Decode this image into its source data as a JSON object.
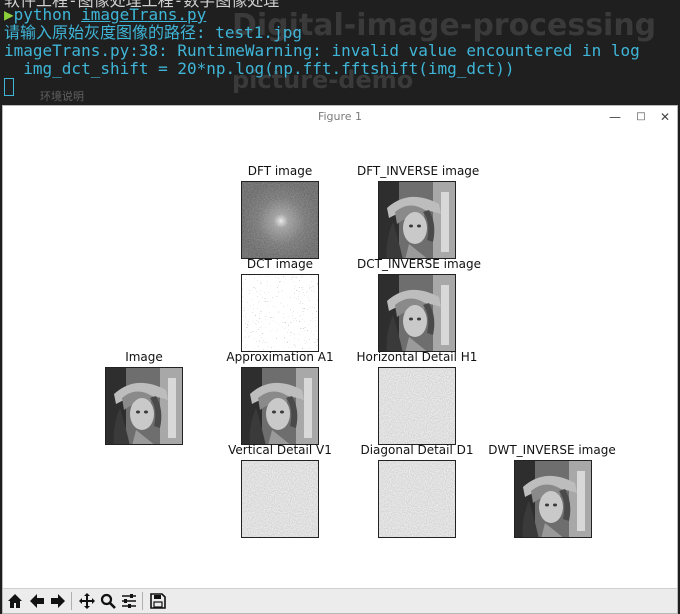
{
  "terminal": {
    "bg_title": "Digital-image-processing",
    "bg_subtitle": "picture-demo",
    "bg_note": "环境说明",
    "line0": "软件工程-图像处理工程-数字图像处理",
    "prompt_arrow": "▶",
    "command": "python",
    "command_arg": "imageTrans.py",
    "line2": "请输入原始灰度图像的路径: test1.jpg",
    "line3": "imageTrans.py:38: RuntimeWarning: invalid value encountered in log",
    "line4": "  img_dct_shift = 20*np.log(np.fft.fftshift(img_dct))"
  },
  "window": {
    "title": "Figure 1",
    "minimize": "—",
    "maximize": "□",
    "close": "✕"
  },
  "subplots": {
    "dft": "DFT image",
    "dft_inverse": "DFT_INVERSE image",
    "dct": "DCT image",
    "dct_inverse": "DCT_INVERSE image",
    "image": "Image",
    "approx": "Approximation A1",
    "horizontal": "Horizontal Detail H1",
    "vertical": "Vertical Detail V1",
    "diagonal": "Diagonal Detail D1",
    "dwt_inverse": "DWT_INVERSE image"
  },
  "toolbar": {
    "icons": [
      "home-icon",
      "back-icon",
      "forward-icon",
      "pan-icon",
      "zoom-icon",
      "configure-subplots-icon",
      "save-icon"
    ]
  }
}
